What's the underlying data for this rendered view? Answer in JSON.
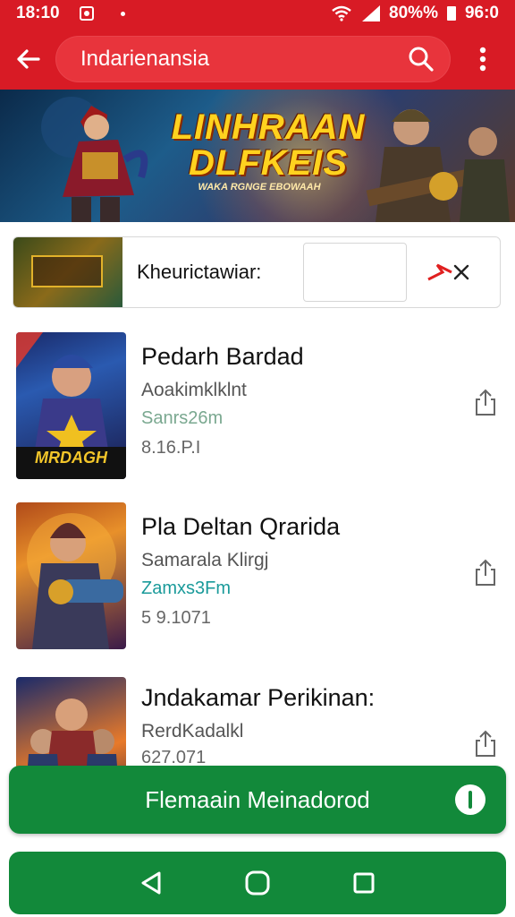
{
  "status_bar": {
    "time": "18:10",
    "battery_percent": "80%%",
    "clock_right": "96:0"
  },
  "app_bar": {
    "search_query": "Indarienansia",
    "icons": [
      "arrow-left-icon",
      "search-icon",
      "more-vert-icon"
    ]
  },
  "banner": {
    "title_line1": "LINHRAAN",
    "title_line2": "DLFKEIS",
    "subtitle": "WAKA RGNGE EBOWAAH"
  },
  "search_result": {
    "label": "Kheurictawiar:",
    "input_value": "",
    "icons": [
      "arrow-icon",
      "close-icon"
    ]
  },
  "items": [
    {
      "name": "Pedarh Bardad",
      "developer": "Aoakimklklnt",
      "size": "Sanrs26m",
      "version": "8.16.P.I",
      "cover_text": "MRDAGH",
      "size_color": "#7aa890"
    },
    {
      "name": "Pla Deltan Qrarida",
      "developer": "Samarala Klirgj",
      "size": "Zamxs3Fm",
      "version": "5 9.1071",
      "size_color": "#1a9a9a"
    },
    {
      "name": "Jndakamar Perikinan:",
      "developer": "RerdKadalkl",
      "size": "",
      "version": "627.071",
      "size_color": "#7aa890"
    }
  ],
  "primary_button": {
    "label": "Flemaain Meinadorod"
  },
  "colors": {
    "header_red": "#d81b25",
    "action_green": "#12893a"
  }
}
